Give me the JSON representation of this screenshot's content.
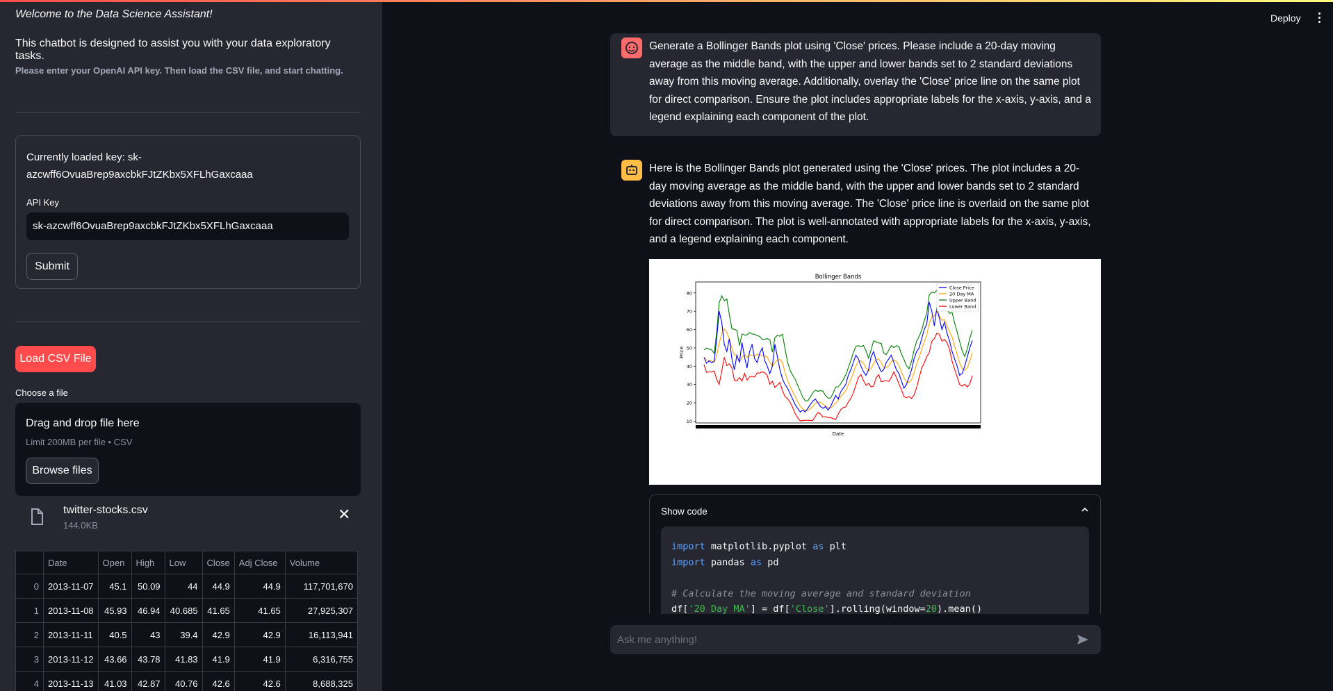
{
  "sidebar": {
    "welcome": "Welcome to the Data Science Assistant!",
    "intro": "This chatbot is designed to assist you with your data exploratory tasks.",
    "hint": "Please enter your OpenAI API key. Then load the CSV file, and start chatting.",
    "key_status_line1": "Currently loaded key: sk-",
    "key_status_line2": "azcwff6OvuaBrep9axcbkFJtZKbx5XFLhGaxcaaa",
    "api_key_label": "API Key",
    "api_key_value": "sk-azcwff6OvuaBrep9axcbkFJtZKbx5XFLhGaxcaaa",
    "submit_label": "Submit",
    "load_csv_label": "Load CSV File",
    "choose_file_label": "Choose a file",
    "dropzone_title": "Drag and drop file here",
    "dropzone_limit": "Limit 200MB per file • CSV",
    "browse_label": "Browse files",
    "file_name": "twitter-stocks.csv",
    "file_size": "144.0KB",
    "table": {
      "columns": [
        "",
        "Date",
        "Open",
        "High",
        "Low",
        "Close",
        "Adj Close",
        "Volume"
      ],
      "rows": [
        [
          "0",
          "2013-11-07",
          "45.1",
          "50.09",
          "44",
          "44.9",
          "44.9",
          "117,701,670"
        ],
        [
          "1",
          "2013-11-08",
          "45.93",
          "46.94",
          "40.685",
          "41.65",
          "41.65",
          "27,925,307"
        ],
        [
          "2",
          "2013-11-11",
          "40.5",
          "43",
          "39.4",
          "42.9",
          "42.9",
          "16,113,941"
        ],
        [
          "3",
          "2013-11-12",
          "43.66",
          "43.78",
          "41.83",
          "41.9",
          "41.9",
          "6,316,755"
        ],
        [
          "4",
          "2013-11-13",
          "41.03",
          "42.87",
          "40.76",
          "42.6",
          "42.6",
          "8,688,325"
        ]
      ]
    }
  },
  "header": {
    "deploy_label": "Deploy"
  },
  "chat": {
    "user_message": "Generate a Bollinger Bands plot using 'Close' prices. Please include a 20-day moving average as the middle band, with the upper and lower bands set to 2 standard deviations away from this moving average. Additionally, overlay the 'Close' price line on the same plot for direct comparison. Ensure the plot includes appropriate labels for the x-axis, y-axis, and a legend explaining each component of the plot.",
    "assistant_message": "Here is the Bollinger Bands plot generated using the 'Close' prices. The plot includes a 20-day moving average as the middle band, with the upper and lower bands set to 2 standard deviations away from this moving average. The 'Close' price line is overlaid on the same plot for direct comparison. The plot is well-annotated with appropriate labels for the x-axis, y-axis, and a legend explaining each component.",
    "expander_label": "Show code",
    "code_lines": {
      "l1_kw": "import",
      "l1_mod": " matplotlib.pyplot ",
      "l1_as": "as",
      "l1_alias": " plt",
      "l2_kw": "import",
      "l2_mod": " pandas ",
      "l2_as": "as",
      "l2_alias": " pd",
      "l4_comment": "# Calculate the moving average and standard deviation",
      "l5_a": "df[",
      "l5_str": "'20 Day MA'",
      "l5_b": "] = df[",
      "l5_str2": "'Close'",
      "l5_c": "].rolling(window=",
      "l5_num": "20",
      "l5_d": ").mean()"
    },
    "input_placeholder": "Ask me anything!"
  },
  "chart_data": {
    "type": "line",
    "title": "Bollinger Bands",
    "xlabel": "Date",
    "ylabel": "Price",
    "yticks": [
      10,
      20,
      30,
      40,
      50,
      60,
      70,
      80
    ],
    "ylim": [
      9,
      86
    ],
    "legend_position": "top-right",
    "series": [
      {
        "name": "Close Price",
        "color": "#0000ff"
      },
      {
        "name": "20 Day MA",
        "color": "#ffa500"
      },
      {
        "name": "Upper Band",
        "color": "#008000"
      },
      {
        "name": "Lower Band",
        "color": "#ff0000"
      }
    ],
    "close_values": [
      44.9,
      41.6,
      42.9,
      41.9,
      42.6,
      55,
      70,
      64,
      52,
      48,
      55,
      44,
      38,
      46,
      42,
      53,
      45,
      39,
      48,
      52,
      44,
      42,
      47,
      50,
      43,
      40,
      36,
      40,
      52,
      45,
      38,
      33,
      30,
      28,
      25,
      22,
      19,
      17,
      15,
      16,
      15,
      17,
      19,
      21,
      22,
      20,
      18,
      17,
      18,
      16,
      18,
      21,
      24,
      22,
      26,
      28,
      30,
      35,
      38,
      42,
      46,
      44,
      40,
      37,
      35,
      38,
      45,
      48,
      43,
      40,
      37,
      38,
      42,
      44,
      46,
      42,
      38,
      36,
      32,
      28,
      30,
      34,
      38,
      44,
      48,
      50,
      55,
      60,
      63,
      75,
      70,
      62,
      72,
      66,
      60,
      64,
      58,
      54,
      48,
      44,
      40,
      35,
      36,
      40,
      45,
      50,
      54
    ]
  }
}
